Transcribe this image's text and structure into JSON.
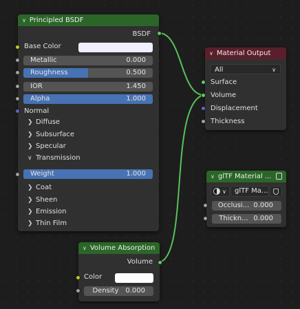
{
  "colors": {
    "link": "#58c25a",
    "socket_float": "#a1a1a1",
    "socket_color": "#c7c729",
    "socket_vector": "#6363c7",
    "socket_shader": "#63c763",
    "slider_fill": "#4772b3"
  },
  "principled": {
    "title": "Principled BSDF",
    "output": "BSDF",
    "base_color_label": "Base Color",
    "metallic": {
      "name": "Metallic",
      "value": "0.000",
      "fraction": 0
    },
    "roughness": {
      "name": "Roughness",
      "value": "0.500",
      "fraction": 0.5
    },
    "ior": {
      "name": "IOR",
      "value": "1.450",
      "fraction": 0
    },
    "alpha": {
      "name": "Alpha",
      "value": "1.000",
      "fraction": 1
    },
    "normal_label": "Normal",
    "panels": {
      "diffuse": "Diffuse",
      "subsurface": "Subsurface",
      "specular": "Specular",
      "transmission": "Transmission",
      "coat": "Coat",
      "sheen": "Sheen",
      "emission": "Emission",
      "thin_film": "Thin Film"
    },
    "weight": {
      "name": "Weight",
      "value": "1.000",
      "fraction": 1
    }
  },
  "material_output": {
    "title": "Material Output",
    "target": "All",
    "inputs": {
      "surface": "Surface",
      "volume": "Volume",
      "displacement": "Displacement",
      "thickness": "Thickness"
    }
  },
  "gltf": {
    "title": "glTF Material ...",
    "datablock": "glTF Ma...",
    "occlusion": {
      "name": "Occlusi...",
      "value": "0.000"
    },
    "thickness": {
      "name": "Thickn...",
      "value": "0.000"
    }
  },
  "volume_absorption": {
    "title": "Volume Absorption",
    "output": "Volume",
    "color_label": "Color",
    "density": {
      "name": "Density",
      "value": "0.000"
    }
  }
}
